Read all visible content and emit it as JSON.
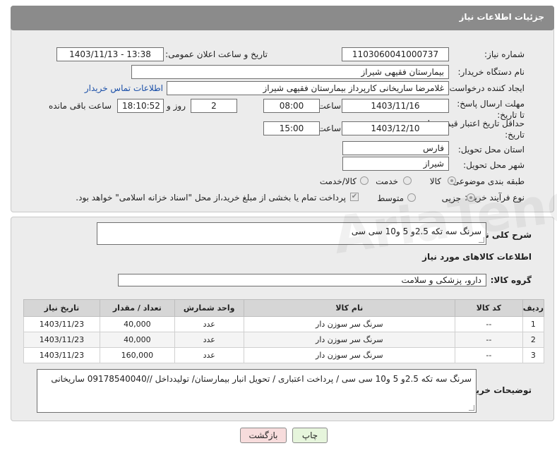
{
  "header": {
    "title": "جزئیات اطلاعات نیاز"
  },
  "form": {
    "need_number_label": "شماره نیاز:",
    "need_number": "1103060041000737",
    "announce_label": "تاریخ و ساعت اعلان عمومی:",
    "announce_value": "1403/11/13 - 13:38",
    "buyer_org_label": "نام دستگاه خریدار:",
    "buyer_org": "بیمارستان فقیهی شیراز",
    "requester_label": "ایجاد کننده درخواست:",
    "requester": "غلامرضا ساریخانی کارپرداز بیمارستان فقیهی شیراز",
    "contact_link": "اطلاعات تماس خریدار",
    "reply_deadline_label": "مهلت ارسال پاسخ: تا تاریخ:",
    "reply_date": "1403/11/16",
    "time_label": "ساعت",
    "reply_time": "08:00",
    "days_value": "2",
    "days_label": "روز و",
    "remaining_time": "18:10:52",
    "remaining_label": "ساعت باقی مانده",
    "price_validity_label": "حداقل تاریخ اعتبار قیمت: تا تاریخ:",
    "price_date": "1403/12/10",
    "price_time": "15:00",
    "province_label": "استان محل تحویل:",
    "province": "فارس",
    "city_label": "شهر محل تحویل:",
    "city": "شیراز",
    "category_label": "طبقه بندی موضوعی:",
    "category_options": [
      "کالا",
      "خدمت",
      "کالا/خدمت"
    ],
    "category_selected": 0,
    "process_label": "نوع فرآیند خرید :",
    "process_options": [
      "جزیی",
      "متوسط"
    ],
    "process_selected": 0,
    "payment_note": "پرداخت تمام یا بخشی از مبلغ خرید،از محل \"اسناد خزانه اسلامی\" خواهد بود."
  },
  "details": {
    "general_desc_label": "شرح کلی نیاز:",
    "general_desc": "سرنگ سه تکه 2.5و 5 و10 سی سی",
    "goods_info_title": "اطلاعات کالاهای مورد نیاز",
    "goods_group_label": "گروه کالا:",
    "goods_group": "دارو، پزشکی و سلامت",
    "table": {
      "headers": [
        "ردیف",
        "کد کالا",
        "نام کالا",
        "واحد شمارش",
        "تعداد / مقدار",
        "تاریخ نیاز"
      ],
      "rows": [
        [
          "1",
          "--",
          "سرنگ سر سوزن دار",
          "عدد",
          "40,000",
          "1403/11/23"
        ],
        [
          "2",
          "--",
          "سرنگ سر سوزن دار",
          "عدد",
          "40,000",
          "1403/11/23"
        ],
        [
          "3",
          "--",
          "سرنگ سر سوزن دار",
          "عدد",
          "160,000",
          "1403/11/23"
        ]
      ]
    },
    "buyer_notes_label": "توضیحات خریدار:",
    "buyer_notes": "سرنگ سه تکه 2.5و 5 و10 سی سی  / پرداخت اعتباری / تحویل انبار بیمارستان/ تولیدداخل //09178540040 ساریخانی"
  },
  "buttons": {
    "print": "چاپ",
    "back": "بازگشت"
  },
  "watermark": "AriaTender.neT",
  "colors": {
    "header_bg": "#8b8b8b",
    "link": "#1a4fa8",
    "print_btn": "#e6f5dc",
    "back_btn": "#f7dcdc"
  }
}
